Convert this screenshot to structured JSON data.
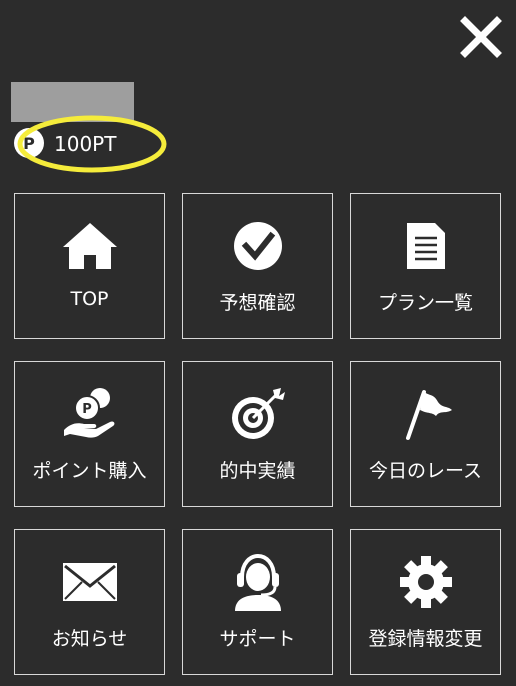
{
  "header": {
    "close_icon": "close-icon"
  },
  "user": {
    "points_icon_letter": "P",
    "points_value": "100PT",
    "highlight_color": "#f5ec3b"
  },
  "menu": {
    "items": [
      {
        "label": "TOP",
        "icon": "home-icon"
      },
      {
        "label": "予想確認",
        "icon": "check-circle-icon"
      },
      {
        "label": "プラン一覧",
        "icon": "document-icon"
      },
      {
        "label": "ポイント購入",
        "icon": "coin-hand-icon"
      },
      {
        "label": "的中実績",
        "icon": "target-icon"
      },
      {
        "label": "今日のレース",
        "icon": "flag-icon"
      },
      {
        "label": "お知らせ",
        "icon": "envelope-icon"
      },
      {
        "label": "サポート",
        "icon": "headset-icon"
      },
      {
        "label": "登録情報変更",
        "icon": "gear-icon"
      }
    ]
  },
  "colors": {
    "background": "#2c2c2c",
    "tile_border": "#d8d8d8",
    "text": "#ffffff",
    "placeholder": "#9e9e9e"
  }
}
